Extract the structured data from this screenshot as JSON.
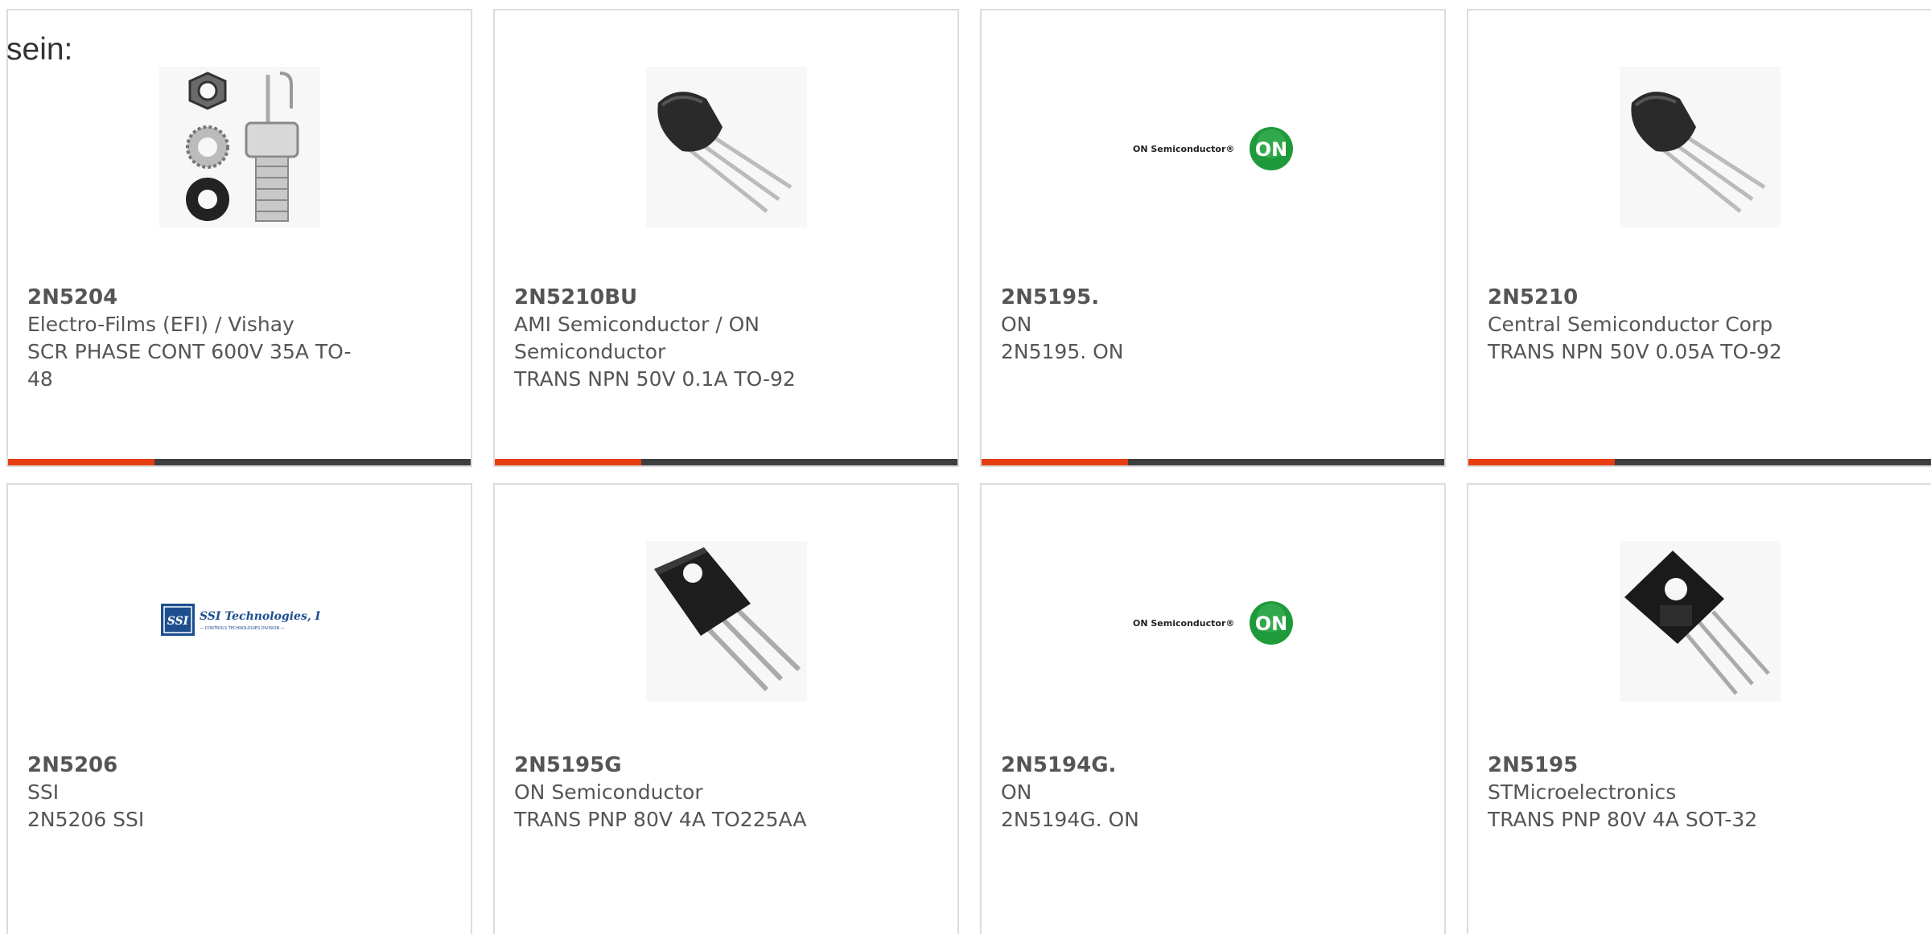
{
  "intro_text": "sein:",
  "accent_color": "#e63e11",
  "products": [
    {
      "part": "2N5204",
      "maker": "Electro-Films (EFI) / Vishay",
      "desc": "SCR PHASE CONT 600V 35A TO-48",
      "image": "scr-stud-icon"
    },
    {
      "part": "2N5210BU",
      "maker": "AMI Semiconductor / ON Semiconductor",
      "desc": "TRANS NPN 50V 0.1A TO-92",
      "image": "to92-transistor-icon"
    },
    {
      "part": "2N5195.",
      "maker": "ON",
      "desc": "2N5195. ON",
      "image": "on-semiconductor-logo"
    },
    {
      "part": "2N5210",
      "maker": "Central Semiconductor Corp",
      "desc": "TRANS NPN 50V 0.05A TO-92",
      "image": "to92-transistor-icon"
    },
    {
      "part": "2N5206",
      "maker": "SSI",
      "desc": "2N5206 SSI",
      "image": "ssi-technologies-logo"
    },
    {
      "part": "2N5195G",
      "maker": "ON Semiconductor",
      "desc": "TRANS PNP 80V 4A TO225AA",
      "image": "to225-transistor-icon"
    },
    {
      "part": "2N5194G.",
      "maker": "ON",
      "desc": "2N5194G. ON",
      "image": "on-semiconductor-logo"
    },
    {
      "part": "2N5195",
      "maker": "STMicroelectronics",
      "desc": "TRANS PNP 80V 4A SOT-32",
      "image": "sot32-transistor-icon"
    }
  ],
  "logos": {
    "on_text": "ON Semiconductor®",
    "on_badge": "ON",
    "ssi_badge": "SSI",
    "ssi_name": "SSI Technologies, Inc.",
    "ssi_sub": "— CONTROLS TECHNOLOGIES DIVISION —"
  }
}
